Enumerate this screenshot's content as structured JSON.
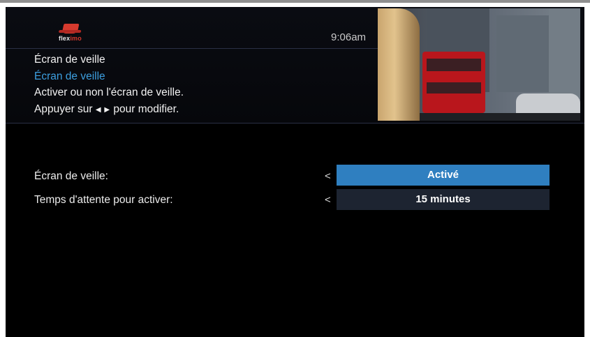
{
  "header": {
    "logo_text_prefix": "flex",
    "logo_text_suffix": "imo",
    "time": "9:06am"
  },
  "info": {
    "title": "Écran de veille",
    "highlighted": "Écran de veille",
    "description": "Activer ou non l'écran de veille.",
    "hint_prefix": "Appuyer sur",
    "hint_arrows": "◀ ▶",
    "hint_suffix": "pour modifier."
  },
  "settings": {
    "rows": [
      {
        "label": "Écran de veille:",
        "chevron": "<",
        "value": "Activé",
        "selected": true
      },
      {
        "label": "Temps d'attente pour activer:",
        "chevron": "<",
        "value": "15 minutes",
        "selected": false
      }
    ]
  },
  "colors": {
    "accent": "#2f7fc0",
    "highlight_text": "#3d9fe0",
    "logo_red": "#d63a2e",
    "idle_row": "#1d2431"
  }
}
